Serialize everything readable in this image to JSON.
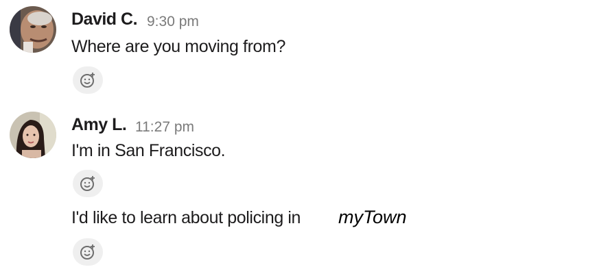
{
  "messages": [
    {
      "author": "David C.",
      "time": "9:30 pm",
      "text": "Where are you moving from?",
      "avatar_icon": "user-avatar-david"
    },
    {
      "author": "Amy L.",
      "time": "11:27 pm",
      "text": "I'm in San Francisco.",
      "avatar_icon": "user-avatar-amy"
    },
    {
      "text": "I'd like to learn about policing in",
      "town": "myTown"
    }
  ],
  "reaction_icon": "add-reaction-icon"
}
